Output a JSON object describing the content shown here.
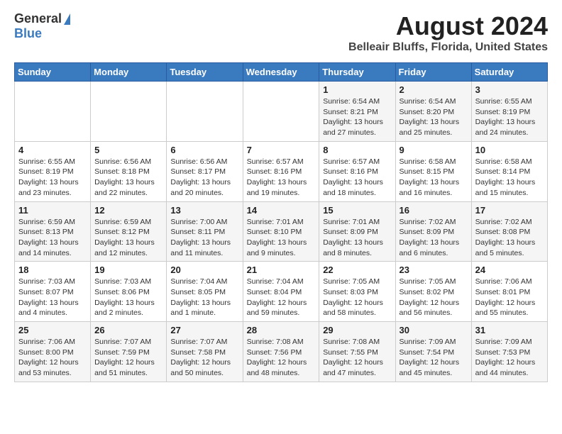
{
  "header": {
    "logo_general": "General",
    "logo_blue": "Blue",
    "title": "August 2024",
    "subtitle": "Belleair Bluffs, Florida, United States"
  },
  "calendar": {
    "days_of_week": [
      "Sunday",
      "Monday",
      "Tuesday",
      "Wednesday",
      "Thursday",
      "Friday",
      "Saturday"
    ],
    "weeks": [
      [
        {
          "day": "",
          "info": ""
        },
        {
          "day": "",
          "info": ""
        },
        {
          "day": "",
          "info": ""
        },
        {
          "day": "",
          "info": ""
        },
        {
          "day": "1",
          "info": "Sunrise: 6:54 AM\nSunset: 8:21 PM\nDaylight: 13 hours\nand 27 minutes."
        },
        {
          "day": "2",
          "info": "Sunrise: 6:54 AM\nSunset: 8:20 PM\nDaylight: 13 hours\nand 25 minutes."
        },
        {
          "day": "3",
          "info": "Sunrise: 6:55 AM\nSunset: 8:19 PM\nDaylight: 13 hours\nand 24 minutes."
        }
      ],
      [
        {
          "day": "4",
          "info": "Sunrise: 6:55 AM\nSunset: 8:19 PM\nDaylight: 13 hours\nand 23 minutes."
        },
        {
          "day": "5",
          "info": "Sunrise: 6:56 AM\nSunset: 8:18 PM\nDaylight: 13 hours\nand 22 minutes."
        },
        {
          "day": "6",
          "info": "Sunrise: 6:56 AM\nSunset: 8:17 PM\nDaylight: 13 hours\nand 20 minutes."
        },
        {
          "day": "7",
          "info": "Sunrise: 6:57 AM\nSunset: 8:16 PM\nDaylight: 13 hours\nand 19 minutes."
        },
        {
          "day": "8",
          "info": "Sunrise: 6:57 AM\nSunset: 8:16 PM\nDaylight: 13 hours\nand 18 minutes."
        },
        {
          "day": "9",
          "info": "Sunrise: 6:58 AM\nSunset: 8:15 PM\nDaylight: 13 hours\nand 16 minutes."
        },
        {
          "day": "10",
          "info": "Sunrise: 6:58 AM\nSunset: 8:14 PM\nDaylight: 13 hours\nand 15 minutes."
        }
      ],
      [
        {
          "day": "11",
          "info": "Sunrise: 6:59 AM\nSunset: 8:13 PM\nDaylight: 13 hours\nand 14 minutes."
        },
        {
          "day": "12",
          "info": "Sunrise: 6:59 AM\nSunset: 8:12 PM\nDaylight: 13 hours\nand 12 minutes."
        },
        {
          "day": "13",
          "info": "Sunrise: 7:00 AM\nSunset: 8:11 PM\nDaylight: 13 hours\nand 11 minutes."
        },
        {
          "day": "14",
          "info": "Sunrise: 7:01 AM\nSunset: 8:10 PM\nDaylight: 13 hours\nand 9 minutes."
        },
        {
          "day": "15",
          "info": "Sunrise: 7:01 AM\nSunset: 8:09 PM\nDaylight: 13 hours\nand 8 minutes."
        },
        {
          "day": "16",
          "info": "Sunrise: 7:02 AM\nSunset: 8:09 PM\nDaylight: 13 hours\nand 6 minutes."
        },
        {
          "day": "17",
          "info": "Sunrise: 7:02 AM\nSunset: 8:08 PM\nDaylight: 13 hours\nand 5 minutes."
        }
      ],
      [
        {
          "day": "18",
          "info": "Sunrise: 7:03 AM\nSunset: 8:07 PM\nDaylight: 13 hours\nand 4 minutes."
        },
        {
          "day": "19",
          "info": "Sunrise: 7:03 AM\nSunset: 8:06 PM\nDaylight: 13 hours\nand 2 minutes."
        },
        {
          "day": "20",
          "info": "Sunrise: 7:04 AM\nSunset: 8:05 PM\nDaylight: 13 hours\nand 1 minute."
        },
        {
          "day": "21",
          "info": "Sunrise: 7:04 AM\nSunset: 8:04 PM\nDaylight: 12 hours\nand 59 minutes."
        },
        {
          "day": "22",
          "info": "Sunrise: 7:05 AM\nSunset: 8:03 PM\nDaylight: 12 hours\nand 58 minutes."
        },
        {
          "day": "23",
          "info": "Sunrise: 7:05 AM\nSunset: 8:02 PM\nDaylight: 12 hours\nand 56 minutes."
        },
        {
          "day": "24",
          "info": "Sunrise: 7:06 AM\nSunset: 8:01 PM\nDaylight: 12 hours\nand 55 minutes."
        }
      ],
      [
        {
          "day": "25",
          "info": "Sunrise: 7:06 AM\nSunset: 8:00 PM\nDaylight: 12 hours\nand 53 minutes."
        },
        {
          "day": "26",
          "info": "Sunrise: 7:07 AM\nSunset: 7:59 PM\nDaylight: 12 hours\nand 51 minutes."
        },
        {
          "day": "27",
          "info": "Sunrise: 7:07 AM\nSunset: 7:58 PM\nDaylight: 12 hours\nand 50 minutes."
        },
        {
          "day": "28",
          "info": "Sunrise: 7:08 AM\nSunset: 7:56 PM\nDaylight: 12 hours\nand 48 minutes."
        },
        {
          "day": "29",
          "info": "Sunrise: 7:08 AM\nSunset: 7:55 PM\nDaylight: 12 hours\nand 47 minutes."
        },
        {
          "day": "30",
          "info": "Sunrise: 7:09 AM\nSunset: 7:54 PM\nDaylight: 12 hours\nand 45 minutes."
        },
        {
          "day": "31",
          "info": "Sunrise: 7:09 AM\nSunset: 7:53 PM\nDaylight: 12 hours\nand 44 minutes."
        }
      ]
    ]
  }
}
